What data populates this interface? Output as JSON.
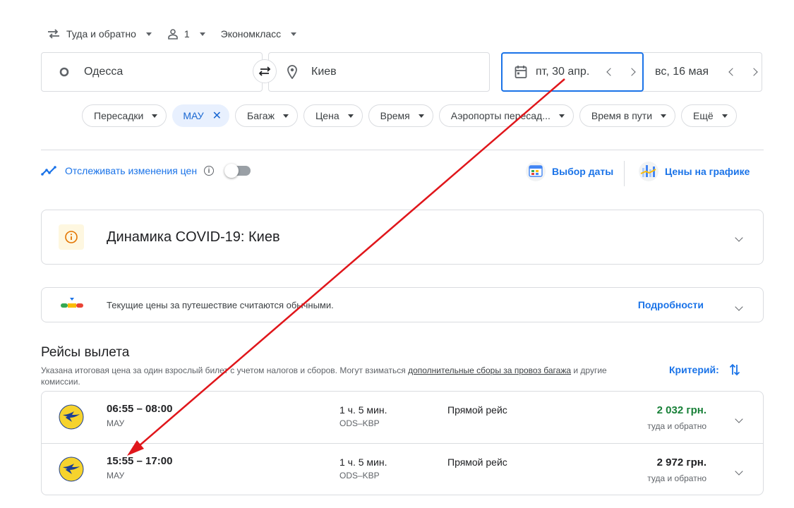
{
  "trip": {
    "type_label": "Туда и обратно",
    "passengers": "1",
    "cabin": "Экономкласс"
  },
  "search": {
    "from": "Одесса",
    "to": "Киев",
    "depart_date": "пт, 30 апр.",
    "return_date": "вс, 16 мая"
  },
  "filters": [
    {
      "label": "Пересадки",
      "selected": false
    },
    {
      "label": "МАУ",
      "selected": true
    },
    {
      "label": "Багаж",
      "selected": false
    },
    {
      "label": "Цена",
      "selected": false
    },
    {
      "label": "Время",
      "selected": false
    },
    {
      "label": "Аэропорты пересад...",
      "selected": false
    },
    {
      "label": "Время в пути",
      "selected": false
    },
    {
      "label": "Ещё",
      "selected": false
    }
  ],
  "tracking": {
    "label": "Отслеживать изменения цен"
  },
  "tools": {
    "date_grid": "Выбор даты",
    "price_graph": "Цены на графике"
  },
  "covid": {
    "title": "Динамика COVID-19: Киев"
  },
  "price_insight": {
    "text": "Текущие цены за путешествие считаются обычными.",
    "more": "Подробности"
  },
  "departures": {
    "title": "Рейсы вылета",
    "note_before": "Указана итоговая цена за один взрослый билет с учетом налогов и сборов. Могут взиматься ",
    "note_link": "дополнительные сборы за провоз багажа",
    "note_after": " и другие комиссии.",
    "sort_label": "Критерий:"
  },
  "flights": [
    {
      "time": "06:55 – 08:00",
      "airline": "МАУ",
      "duration": "1 ч. 5 мин.",
      "route": "ODS–KBP",
      "stops": "Прямой рейс",
      "price": "2 032 грн.",
      "price_type": "туда и обратно",
      "cheapest": true
    },
    {
      "time": "15:55 – 17:00",
      "airline": "МАУ",
      "duration": "1 ч. 5 мин.",
      "route": "ODS–KBP",
      "stops": "Прямой рейс",
      "price": "2 972 грн.",
      "price_type": "туда и обратно",
      "cheapest": false
    }
  ],
  "colors": {
    "accent": "#1a73e8",
    "annotation_arrow": "#e0161b",
    "cheap_price": "#188038"
  }
}
